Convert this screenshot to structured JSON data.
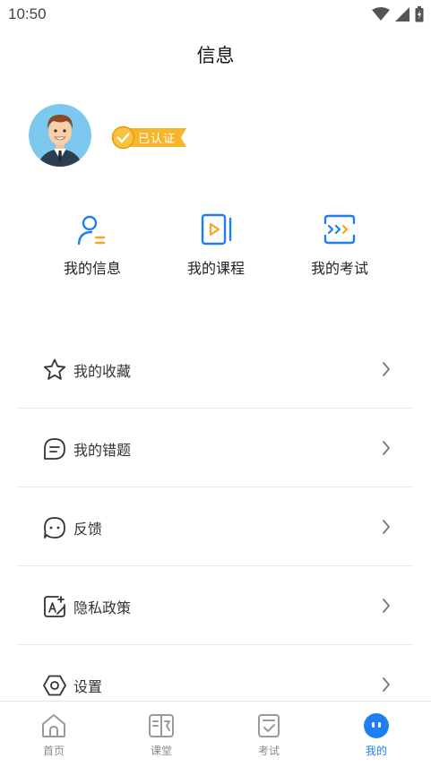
{
  "status_bar": {
    "time": "10:50"
  },
  "header": {
    "title": "信息"
  },
  "profile": {
    "badge_label": "已认证"
  },
  "shortcuts": [
    {
      "label": "我的信息",
      "icon": "user-info-icon"
    },
    {
      "label": "我的课程",
      "icon": "course-icon"
    },
    {
      "label": "我的考试",
      "icon": "exam-icon"
    }
  ],
  "menu": [
    {
      "label": "我的收藏",
      "icon": "star-icon"
    },
    {
      "label": "我的错题",
      "icon": "wrong-question-icon"
    },
    {
      "label": "反馈",
      "icon": "feedback-icon"
    },
    {
      "label": "隐私政策",
      "icon": "privacy-icon"
    },
    {
      "label": "设置",
      "icon": "settings-icon"
    }
  ],
  "tabbar": [
    {
      "label": "首页",
      "icon": "home-icon"
    },
    {
      "label": "课堂",
      "icon": "classroom-icon"
    },
    {
      "label": "考试",
      "icon": "exam-tab-icon"
    },
    {
      "label": "我的",
      "icon": "mine-icon",
      "active": true
    }
  ],
  "colors": {
    "accent": "#1f7ff0",
    "badge": "#f5a623",
    "icon_gray": "#333333"
  }
}
